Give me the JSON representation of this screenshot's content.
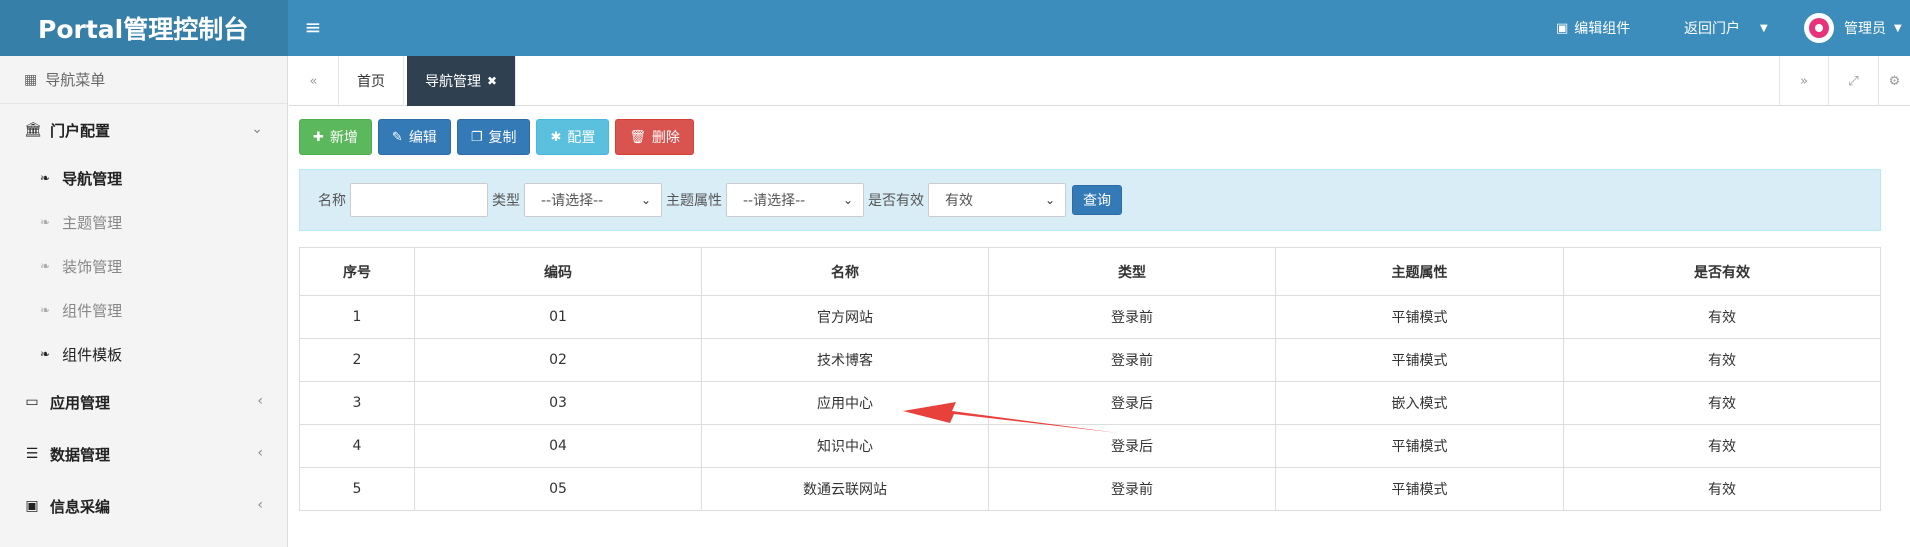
{
  "header": {
    "brand": "Portal管理控制台",
    "edit_widget": "编辑组件",
    "back_portal": "返回门户",
    "user": "管理员"
  },
  "sidebar": {
    "title": "导航菜单",
    "groups": [
      {
        "label": "门户配置",
        "expanded": true,
        "items": [
          {
            "label": "导航管理",
            "active": true
          },
          {
            "label": "主题管理"
          },
          {
            "label": "装饰管理"
          },
          {
            "label": "组件管理"
          },
          {
            "label": "组件模板"
          }
        ]
      },
      {
        "label": "应用管理"
      },
      {
        "label": "数据管理"
      },
      {
        "label": "信息采编"
      }
    ]
  },
  "tabs": [
    {
      "label": "首页"
    },
    {
      "label": "导航管理",
      "active": true
    }
  ],
  "toolbar": {
    "add": "新增",
    "edit": "编辑",
    "copy": "复制",
    "config": "配置",
    "delete": "删除"
  },
  "search": {
    "name_label": "名称",
    "name_value": "",
    "type_label": "类型",
    "type_value": "--请选择--",
    "theme_label": "主题属性",
    "theme_value": "--请选择--",
    "valid_label": "是否有效",
    "valid_value": "有效",
    "query": "查询"
  },
  "table": {
    "columns": [
      "序号",
      "编码",
      "名称",
      "类型",
      "主题属性",
      "是否有效"
    ],
    "rows": [
      [
        "1",
        "01",
        "官方网站",
        "登录前",
        "平铺模式",
        "有效"
      ],
      [
        "2",
        "02",
        "技术博客",
        "登录前",
        "平铺模式",
        "有效"
      ],
      [
        "3",
        "03",
        "应用中心",
        "登录后",
        "嵌入模式",
        "有效"
      ],
      [
        "4",
        "04",
        "知识中心",
        "登录后",
        "平铺模式",
        "有效"
      ],
      [
        "5",
        "05",
        "数通云联网站",
        "登录前",
        "平铺模式",
        "有效"
      ]
    ]
  },
  "colors": {
    "header": "#3c8dbc",
    "brand": "#367fa9",
    "active_tab": "#2f4050",
    "annotation_arrow": "#e8403a"
  }
}
